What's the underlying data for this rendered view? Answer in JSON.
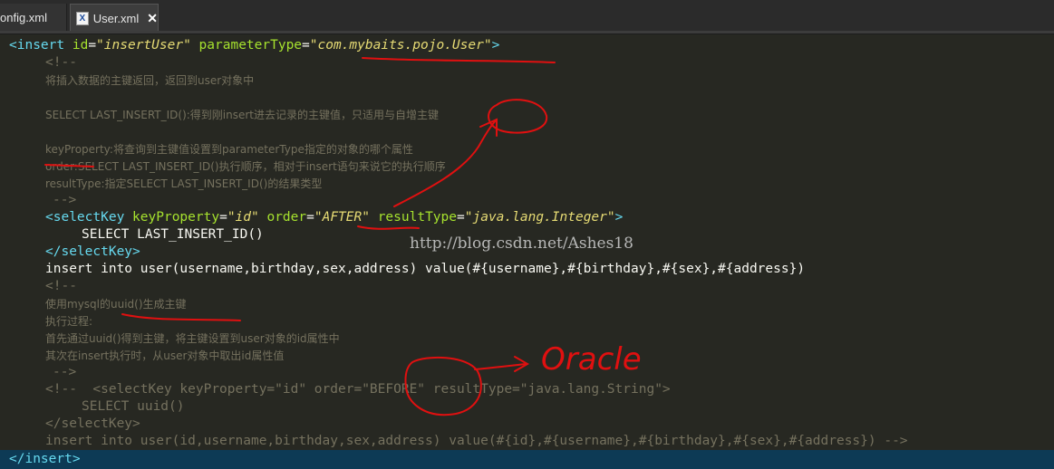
{
  "tabs": [
    {
      "label": "onfig.xml",
      "active": false
    },
    {
      "label": "User.xml",
      "active": true,
      "icon": "xml-file-icon"
    }
  ],
  "code": {
    "l1": {
      "open": "<insert",
      "id_attr": "id",
      "id_val": "\"insertUser\"",
      "pt_attr": "parameterType",
      "pt_val": "\"com.mybaits.pojo.User\"",
      "close": ">"
    },
    "l2": "<!--",
    "l3": "将插入数据的主键返回，返回到user对象中",
    "l5": "SELECT LAST_INSERT_ID():得到刚insert进去记录的主键值，只适用与自增主键",
    "l7": "keyProperty:将查询到主键值设置到parameterType指定的对象的哪个属性",
    "l8": "order:SELECT LAST_INSERT_ID()执行顺序，相对于insert语句来说它的执行顺序",
    "l9": "resultType:指定SELECT LAST_INSERT_ID()的结果类型",
    "l10": "-->",
    "l11": {
      "open": "<selectKey",
      "kp_attr": "keyProperty",
      "kp_val": "\"id\"",
      "order_attr": "order",
      "order_val": "\"AFTER\"",
      "rt_attr": "resultType",
      "rt_val": "\"java.lang.Integer\"",
      "close": ">"
    },
    "l12": "SELECT LAST_INSERT_ID()",
    "l13": "</selectKey>",
    "l14": "insert into user(username,birthday,sex,address) value(#{username},#{birthday},#{sex},#{address})",
    "l15": "<!--",
    "l16": "使用mysql的uuid()生成主键",
    "l17": "执行过程:",
    "l18": "首先通过uuid()得到主键，将主键设置到user对象的id属性中",
    "l19": "其次在insert执行时，从user对象中取出id属性值",
    "l20": "-->",
    "l21": "<!--  <selectKey keyProperty=\"id\" order=\"BEFORE\" resultType=\"java.lang.String\">",
    "l22": "SELECT uuid()",
    "l23": "</selectKey>",
    "l24": "insert into user(id,username,birthday,sex,address) value(#{id},#{username},#{birthday},#{sex},#{address}) -->",
    "l25": "</insert>"
  },
  "watermark": "http://blog.csdn.net/Ashes18",
  "annotation_text": "Oracle",
  "colors": {
    "annotation": "#e01010",
    "background": "#272822",
    "tag": "#66d9ef",
    "attribute": "#a6e22e",
    "value": "#e6db74",
    "comment": "#75715e"
  }
}
